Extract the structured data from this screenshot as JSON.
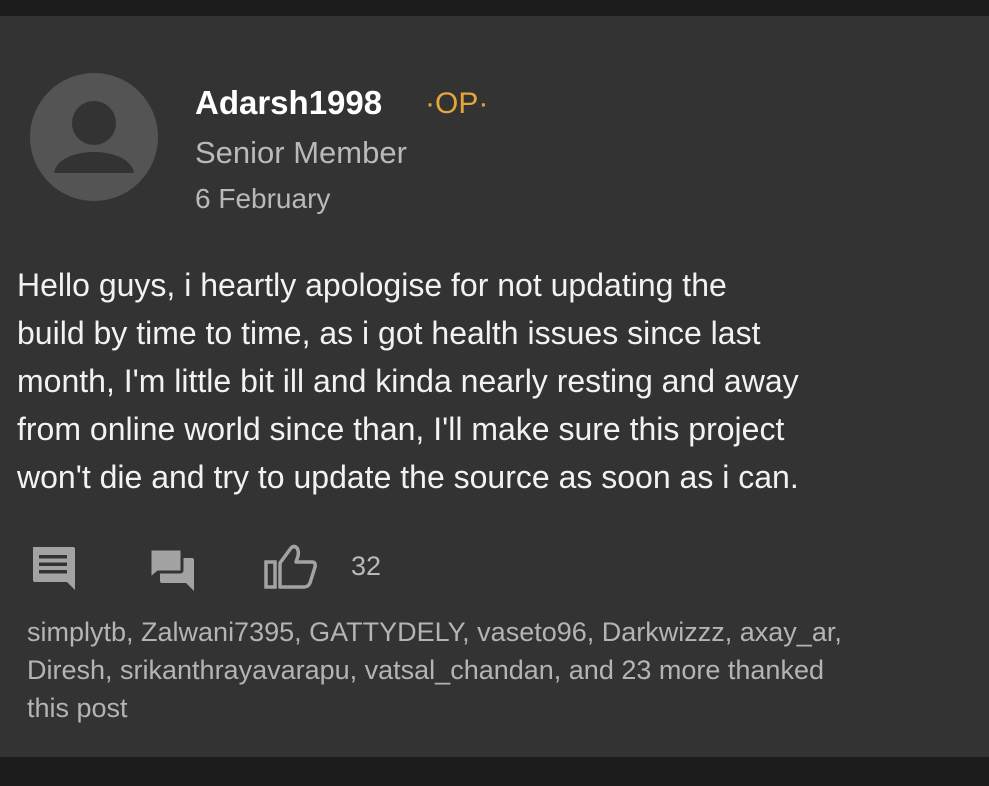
{
  "post": {
    "author": "Adarsh1998",
    "op_badge": "·OP·",
    "rank": "Senior Member",
    "date": "6 February",
    "body_lines": [
      "Hello guys, i heartly apologise for not updating the",
      "build by time to time, as i got health issues since last",
      "month, I'm little bit ill and kinda nearly resting and away",
      "from online world since than, I'll make sure this project",
      "won't die and try to update the source as soon as i can."
    ],
    "thanks_count": "32",
    "thanked_by_lines": [
      "simplytb, Zalwani7395, GATTYDELY, vaseto96, Darkwizzz, axay_ar,",
      "Diresh, srikanthrayavarapu, vatsal_chandan, and 23 more thanked",
      "this post"
    ]
  },
  "icons": {
    "avatar": "default-avatar-icon",
    "reply": "reply-comment-icon",
    "quote": "quote-forum-icon",
    "thanks": "thumbs-up-icon"
  },
  "colors": {
    "background": "#333333",
    "op_badge": "#e6a53a",
    "text_primary": "#f2f2f2",
    "text_secondary": "#b9b9b9",
    "icon": "#9e9e9e"
  }
}
